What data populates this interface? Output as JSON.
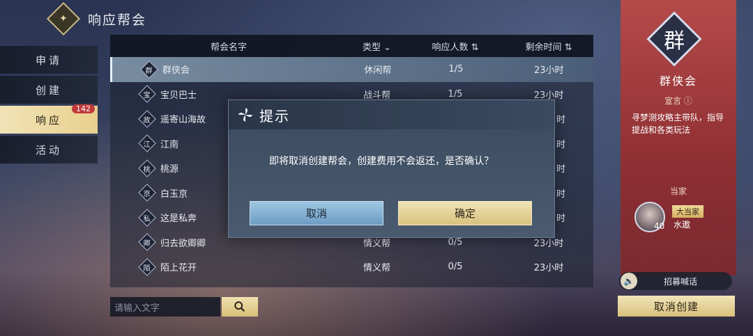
{
  "header": {
    "title": "响应帮会"
  },
  "side_tabs": [
    {
      "label": "申请"
    },
    {
      "label": "创建"
    },
    {
      "label": "响应",
      "badge": "142",
      "active": true
    },
    {
      "label": "活动"
    }
  ],
  "table": {
    "headers": {
      "name": "帮会名字",
      "type": "类型",
      "count": "响应人数",
      "time": "剩余时间"
    },
    "rows": [
      {
        "emblem": "群",
        "name": "群侠会",
        "type": "休闲帮",
        "count": "1/5",
        "time": "23小时"
      },
      {
        "emblem": "宝",
        "name": "宝贝巴士",
        "type": "战斗帮",
        "count": "1/5",
        "time": "23小时"
      },
      {
        "emblem": "故",
        "name": "遥寄山海故",
        "type": "",
        "count": "",
        "time": "时"
      },
      {
        "emblem": "江",
        "name": "江南",
        "type": "",
        "count": "",
        "time": "时"
      },
      {
        "emblem": "桃",
        "name": "桃源",
        "type": "",
        "count": "",
        "time": "时"
      },
      {
        "emblem": "京",
        "name": "白玉京",
        "type": "",
        "count": "",
        "time": "时"
      },
      {
        "emblem": "私",
        "name": "这是私奔",
        "type": "",
        "count": "",
        "time": "时"
      },
      {
        "emblem": "卿",
        "name": "归去欲卿卿",
        "type": "情义帮",
        "count": "0/5",
        "time": "23小时"
      },
      {
        "emblem": "陌",
        "name": "陌上花开",
        "type": "情义帮",
        "count": "0/5",
        "time": "23小时"
      }
    ]
  },
  "search": {
    "placeholder": "请输入文字"
  },
  "guild_panel": {
    "emblem": "群",
    "name": "群侠会",
    "motto_label": "宣言",
    "motto": "寻梦测攻略主带队，指导提战和各类玩法",
    "leader_label": "当家",
    "leader_tag": "大当家",
    "leader_name": "水遨",
    "leader_level": "40"
  },
  "recruit_label": "招募喊话",
  "cancel_create_label": "取消创建",
  "dialog": {
    "title": "提示",
    "message": "即将取消创建帮会，创建费用不会返还，是否确认？",
    "cancel_label": "取消",
    "confirm_label": "确定"
  }
}
